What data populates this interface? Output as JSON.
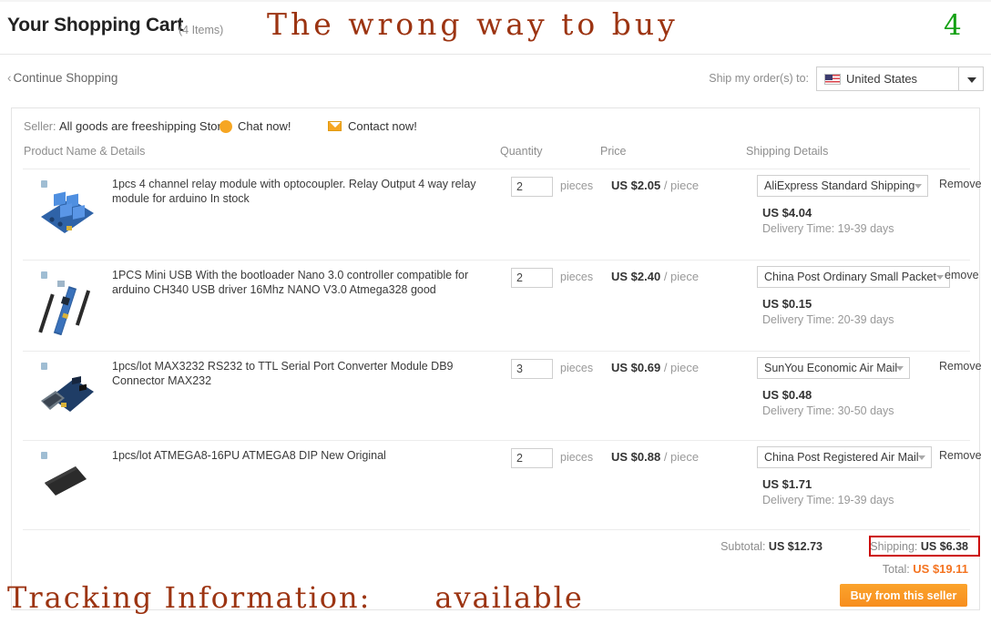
{
  "header": {
    "title": "Your Shopping Cart",
    "item_count": "(4 Items)",
    "annotation_top": "The wrong way to buy",
    "annotation_number": "4",
    "annotation_color": "#9c3412",
    "annotation_number_color": "#15a115"
  },
  "shipbar": {
    "continue_shopping": "Continue Shopping",
    "chevron": "‹",
    "ship_to_label": "Ship my order(s) to:",
    "country": "United States",
    "country_icon": "us-flag-icon"
  },
  "seller": {
    "label": "Seller:",
    "name": "All goods are freeshipping Store",
    "chat_label": "Chat now!",
    "chat_icon": "chat-bubble-icon",
    "contact_label": "Contact now!",
    "contact_icon": "envelope-icon"
  },
  "columns": {
    "product": "Product Name & Details",
    "quantity": "Quantity",
    "price": "Price",
    "shipping": "Shipping Details"
  },
  "items": [
    {
      "name": "1pcs 4 channel relay module with optocoupler. Relay Output 4 way relay module for arduino In stock",
      "qty": "2",
      "unit": "pieces",
      "price": "US $2.05",
      "price_per": "/ piece",
      "shipping_method": "AliExpress Standard Shipping",
      "shipping_cost": "US $4.04",
      "delivery": "Delivery Time: 19-39 days",
      "remove": "Remove",
      "thumb": "relay-module-thumbnail"
    },
    {
      "name": "1PCS Mini USB With the bootloader Nano 3.0 controller compatible for arduino CH340 USB driver 16Mhz NANO V3.0 Atmega328 good",
      "qty": "2",
      "unit": "pieces",
      "price": "US $2.40",
      "price_per": "/ piece",
      "shipping_method": "China Post Ordinary Small Packet",
      "shipping_cost": "US $0.15",
      "delivery": "Delivery Time: 20-39 days",
      "remove": "emove",
      "thumb": "arduino-nano-thumbnail"
    },
    {
      "name": "1pcs/lot MAX3232 RS232 to TTL Serial Port Converter Module DB9 Connector MAX232",
      "qty": "3",
      "unit": "pieces",
      "price": "US $0.69",
      "price_per": "/ piece",
      "shipping_method": "SunYou Economic Air Mail",
      "shipping_cost": "US $0.48",
      "delivery": "Delivery Time: 30-50 days",
      "remove": "Remove",
      "thumb": "max3232-module-thumbnail"
    },
    {
      "name": "1pcs/lot ATMEGA8-16PU ATMEGA8 DIP New Original",
      "qty": "2",
      "unit": "pieces",
      "price": "US $0.88",
      "price_per": "/ piece",
      "shipping_method": "China Post Registered Air Mail",
      "shipping_cost": "US $1.71",
      "delivery": "Delivery Time: 19-39 days",
      "remove": "Remove",
      "thumb": "atmega8-dip-thumbnail"
    }
  ],
  "totals": {
    "subtotal_label": "Subtotal:",
    "subtotal_value": "US $12.73",
    "shipping_label": "Shipping:",
    "shipping_value": "US $6.38",
    "shipping_highlight_color": "#cc0000",
    "total_label": "Total:",
    "total_value": "US $19.11",
    "total_color": "#f47421",
    "buy_button": "Buy from this seller",
    "buy_button_color": "#f78e1e"
  },
  "annotation_bottom": {
    "text_left": "Tracking Information:",
    "text_right": "available",
    "color": "#9c3412"
  }
}
